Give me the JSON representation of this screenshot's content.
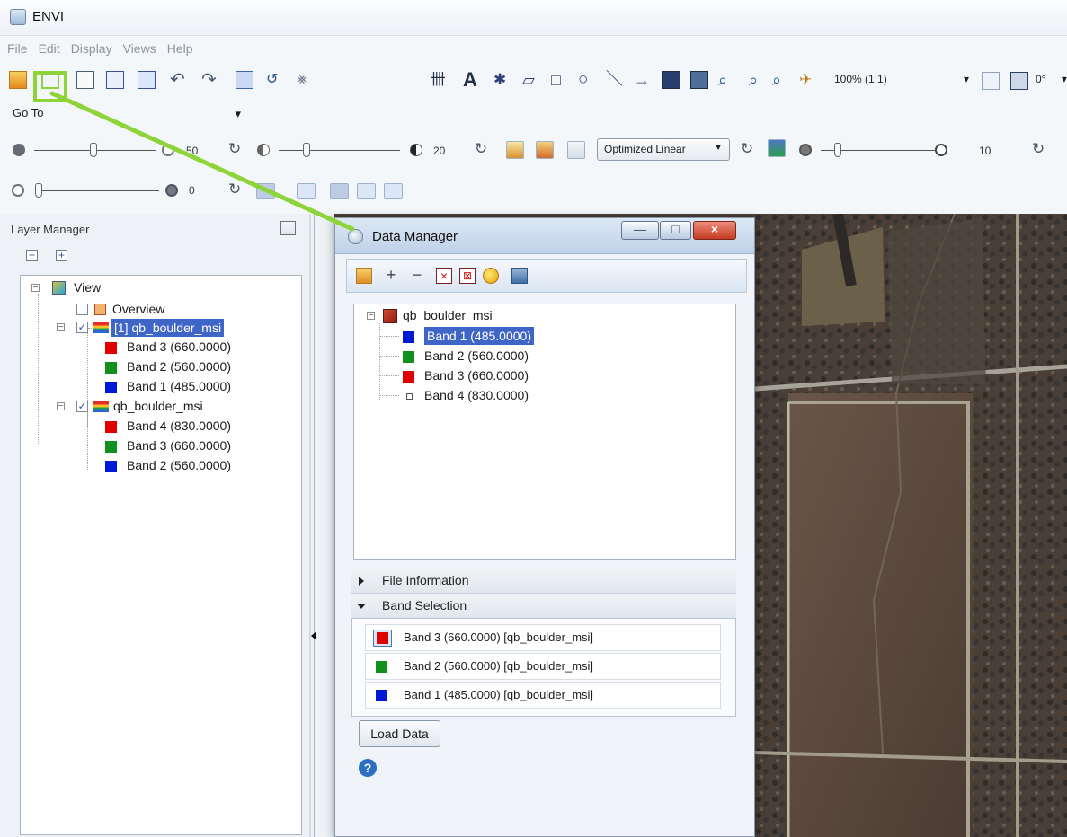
{
  "app": {
    "title": "ENVI",
    "menus": [
      "File",
      "Edit",
      "Display",
      "Views",
      "Help"
    ]
  },
  "toolbar": {
    "zoom_value": "100% (1:1)",
    "rotation_value": "0°"
  },
  "goto": {
    "label": "Go To"
  },
  "sliders": {
    "brightness_value": "50",
    "contrast_value": "20",
    "stretch_mode": "Optimized Linear",
    "sharpen_value": "10",
    "transparency_value": "0"
  },
  "layer_manager": {
    "title": "Layer Manager",
    "tree": {
      "root": "View",
      "overview": "Overview",
      "layers": [
        {
          "name": "[1] qb_boulder_msi",
          "bands": [
            {
              "label": "Band 3 (660.0000)",
              "color": "#e00000"
            },
            {
              "label": "Band 2 (560.0000)",
              "color": "#10901c"
            },
            {
              "label": "Band 1 (485.0000)",
              "color": "#0019d6"
            }
          ]
        },
        {
          "name": "qb_boulder_msi",
          "bands": [
            {
              "label": "Band 4 (830.0000)",
              "color": "#e00000"
            },
            {
              "label": "Band 3 (660.0000)",
              "color": "#10901c"
            },
            {
              "label": "Band 2 (560.0000)",
              "color": "#0019d6"
            }
          ]
        }
      ]
    }
  },
  "data_manager": {
    "title": "Data Manager",
    "file": "qb_boulder_msi",
    "bands": [
      {
        "label": "Band 1 (485.0000)",
        "color": "#0019d6"
      },
      {
        "label": "Band 2 (560.0000)",
        "color": "#10901c"
      },
      {
        "label": "Band 3 (660.0000)",
        "color": "#e00000"
      },
      {
        "label": "Band 4 (830.0000)",
        "color": "#ffffff"
      }
    ],
    "sections": {
      "file_information": "File Information",
      "band_selection": "Band Selection"
    },
    "band_selection": [
      {
        "label": "Band 3 (660.0000) [qb_boulder_msi]",
        "color": "#e00000"
      },
      {
        "label": "Band 2 (560.0000) [qb_boulder_msi]",
        "color": "#10901c"
      },
      {
        "label": "Band 1 (485.0000) [qb_boulder_msi]",
        "color": "#0019d6"
      }
    ],
    "load_button": "Load Data",
    "help_icon": "?"
  },
  "colors": {
    "callout": "#8fd33a",
    "selection": "#3f66c7"
  }
}
